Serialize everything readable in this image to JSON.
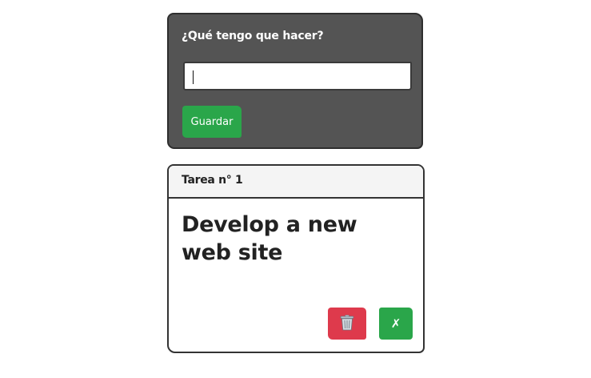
{
  "form": {
    "label": "¿Qué tengo que hacer?",
    "input_value": "",
    "save_label": "Guardar"
  },
  "tasks": [
    {
      "number_label": "Tarea n° 1",
      "title": "Develop a new web site",
      "delete_icon": "trash-icon",
      "complete_icon": "cross-mark-icon",
      "complete_glyph": "✗"
    }
  ],
  "colors": {
    "form_background": "#545454",
    "save_button": "#2aa64a",
    "delete_button": "#de3a4c",
    "complete_button": "#2aa64a",
    "task_header": "#f4f4f4"
  }
}
